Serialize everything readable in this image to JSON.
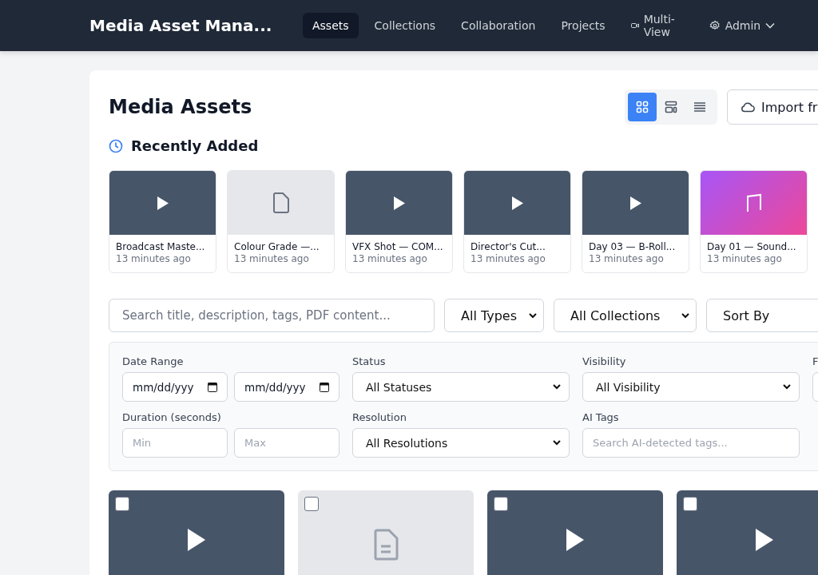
{
  "app": {
    "title": "Media Asset Mana..."
  },
  "nav": [
    {
      "label": "Assets",
      "selected": true,
      "kind": "plain"
    },
    {
      "label": "Collections",
      "selected": false,
      "kind": "plain"
    },
    {
      "label": "Collaboration",
      "selected": false,
      "kind": "plain"
    },
    {
      "label": "Projects",
      "selected": false,
      "kind": "plain"
    },
    {
      "label": "Multi-View",
      "selected": false,
      "kind": "camera"
    },
    {
      "label": "Admin",
      "selected": false,
      "kind": "menu"
    }
  ],
  "page": {
    "title": "Media Assets",
    "import_button": "Import fr"
  },
  "view_modes": [
    {
      "kind": "grid",
      "selected": true
    },
    {
      "kind": "cards",
      "selected": false
    },
    {
      "kind": "list",
      "selected": false
    }
  ],
  "recent": {
    "title": "Recently Added",
    "items": [
      {
        "kind": "video",
        "title": "Broadcast Maste...",
        "time": "13 minutes ago"
      },
      {
        "kind": "document",
        "title": "Colour Grade —...",
        "time": "13 minutes ago"
      },
      {
        "kind": "video",
        "title": "VFX Shot — COM...",
        "time": "13 minutes ago"
      },
      {
        "kind": "video",
        "title": "Director's Cut...",
        "time": "13 minutes ago"
      },
      {
        "kind": "video",
        "title": "Day 03 — B-Roll...",
        "time": "13 minutes ago"
      },
      {
        "kind": "audio",
        "title": "Day 01 — Sound...",
        "time": "13 minutes ago"
      }
    ]
  },
  "search": {
    "placeholder": "Search title, description, tags, PDF content..."
  },
  "dropdowns": [
    "All Types",
    "All Collections",
    "Sort By"
  ],
  "filters": [
    {
      "label": "Date Range",
      "kind": "dates",
      "fields": [
        "mm/dd/yyy",
        "mm/dd/yyy"
      ]
    },
    {
      "label": "Status",
      "kind": "select",
      "value": "All Statuses"
    },
    {
      "label": "Visibility",
      "kind": "select",
      "value": "All Visibility"
    },
    {
      "label": "F",
      "kind": "cut"
    },
    {
      "label": "Duration (seconds)",
      "kind": "range",
      "placeholders": [
        "Min",
        "Max"
      ]
    },
    {
      "label": "Resolution",
      "kind": "select",
      "value": "All Resolutions"
    },
    {
      "label": "AI Tags",
      "kind": "text",
      "placeholder": "Search AI-detected tags..."
    }
  ],
  "assets": [
    {
      "kind": "video",
      "checked": false
    },
    {
      "kind": "document",
      "checked": false
    },
    {
      "kind": "video",
      "checked": false
    },
    {
      "kind": "video",
      "checked": false
    }
  ]
}
